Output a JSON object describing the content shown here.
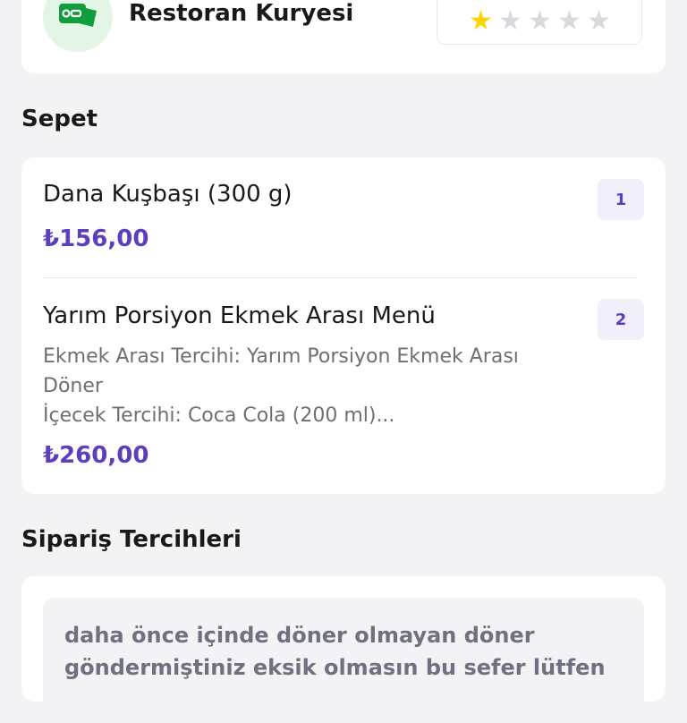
{
  "courier": {
    "name": "Restoran Kuryesi",
    "icon": "courier-ticket-icon",
    "rating": 1,
    "rating_max": 5,
    "colors": {
      "avatar_bg": "#e3f5e6",
      "icon": "#0f9e3b",
      "star_filled": "#ffd300",
      "star_empty": "#d9d9dd"
    }
  },
  "basket": {
    "title": "Sepet",
    "items": [
      {
        "name": "Dana Kuşbaşı (300 g)",
        "price": "₺156,00",
        "quantity": "1"
      },
      {
        "name": "Yarım Porsiyon Ekmek Arası Menü",
        "description_lines": [
          "Ekmek Arası Tercihi: Yarım Porsiyon Ekmek Arası",
          "Döner",
          "İçecek Tercihi: Coca Cola (200 ml)..."
        ],
        "price": "₺260,00",
        "quantity": "2"
      }
    ]
  },
  "preferences": {
    "title": "Sipariş Tercihleri",
    "note_lines": [
      "daha önce içinde döner olmayan döner",
      "göndermiştiniz eksik olmasın bu sefer lütfen"
    ]
  },
  "theme": {
    "accent": "#5d3ebc",
    "background": "#f3f3f5"
  }
}
